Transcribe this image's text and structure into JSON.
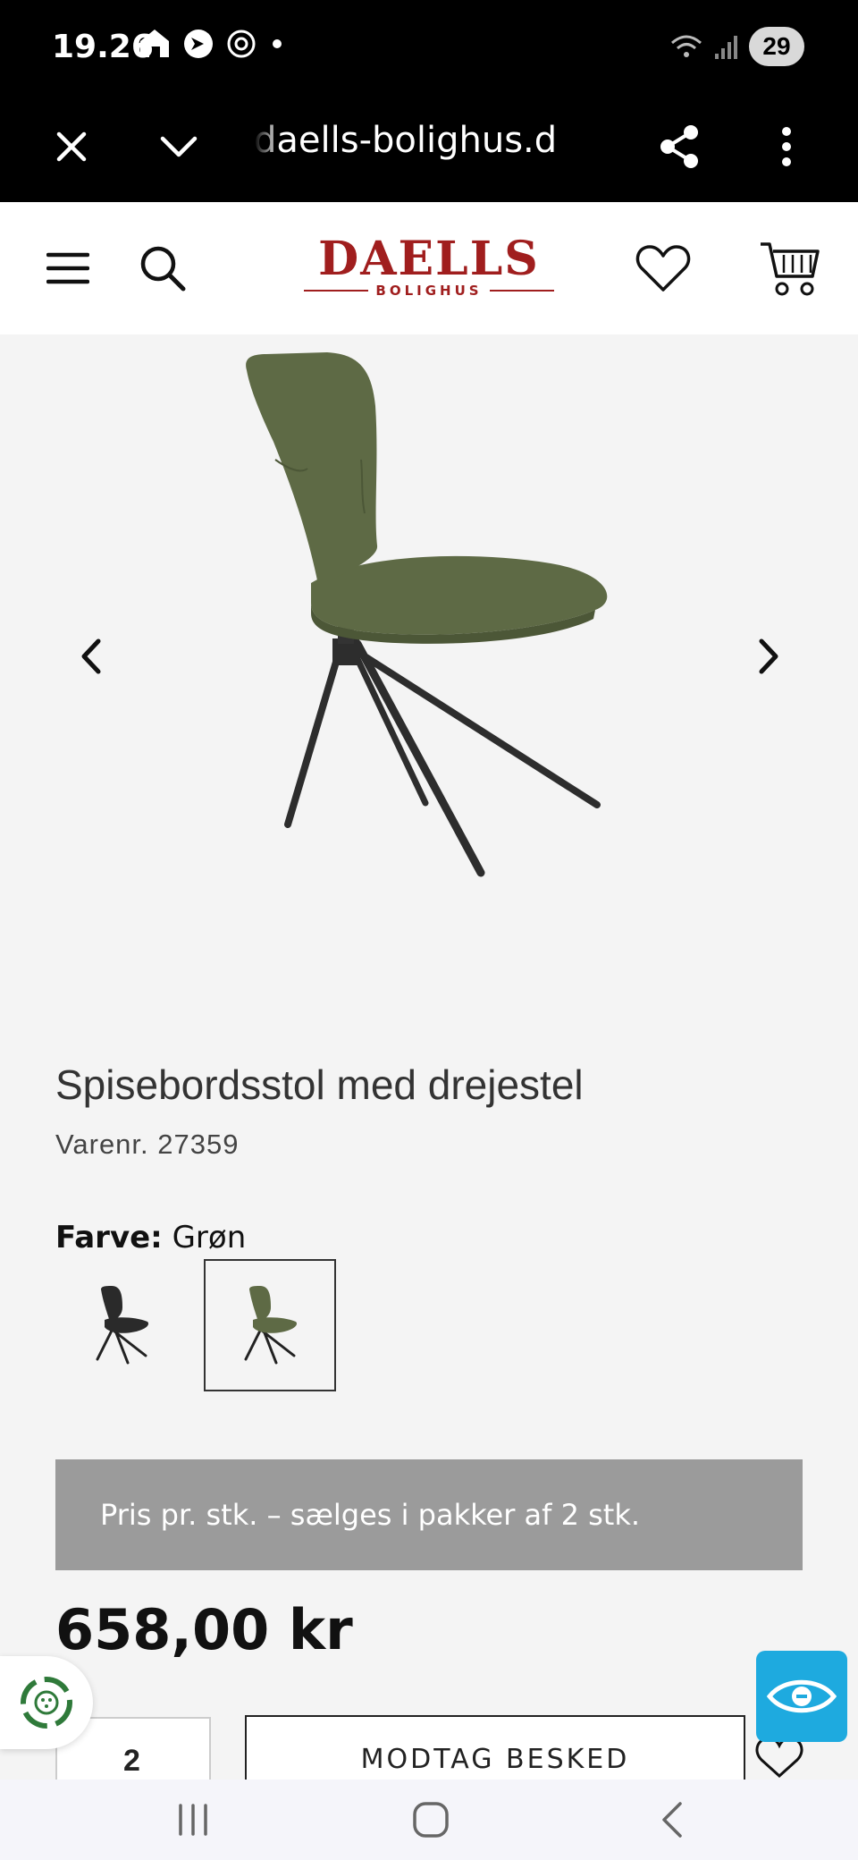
{
  "status_bar": {
    "time": "19.26",
    "battery": "29",
    "left_icons": [
      "home-app-icon",
      "prime-video-icon",
      "chatgpt-icon",
      "dot-icon"
    ],
    "right_icons": [
      "wifi-icon",
      "signal-icon"
    ]
  },
  "browser": {
    "url": "daells-bolighus.dk",
    "close_icon": "close-icon",
    "menu_icon": "chevron-down-icon",
    "share_icon": "share-icon",
    "more_icon": "more-vert-icon"
  },
  "header": {
    "logo_main": "DAELLS",
    "logo_sub": "BOLIGHUS",
    "brand_color": "#a01e1e"
  },
  "gallery": {
    "prev_icon": "chevron-left-icon",
    "next_icon": "chevron-right-icon",
    "image_color": "#5e6a45"
  },
  "product": {
    "title": "Spisebordsstol med drejestel",
    "sku": "Varenr. 27359",
    "color_label": "Farve:",
    "color_value": "Grøn",
    "swatches": [
      {
        "name": "Sort",
        "color": "#2a2a2a",
        "selected": false
      },
      {
        "name": "Grøn",
        "color": "#5e6a45",
        "selected": true
      }
    ],
    "notice": "Pris pr. stk. – sælges i pakker af 2 stk.",
    "price": "658,00 kr",
    "quantity": "2",
    "notify_button": "MODTAG BESKED"
  },
  "colors": {
    "notice_bg": "#9b9b9b",
    "eye_button": "#1eaadf"
  }
}
